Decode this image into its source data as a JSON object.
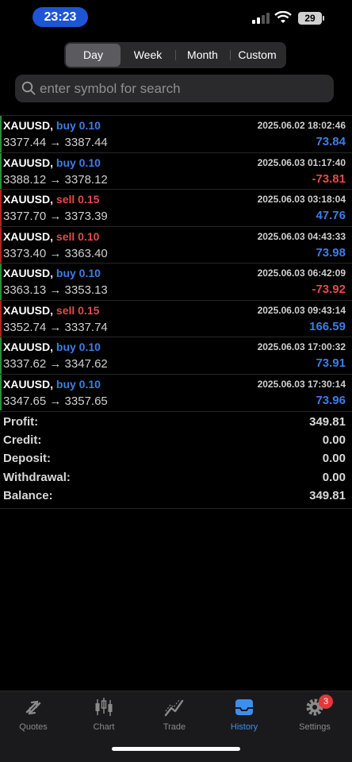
{
  "status_bar": {
    "time": "23:23",
    "battery": "29"
  },
  "period_tabs": [
    "Day",
    "Week",
    "Month",
    "Custom"
  ],
  "active_period": "Day",
  "search": {
    "placeholder": "enter symbol for search"
  },
  "deals": [
    {
      "symbol": "XAUUSD,",
      "type": "buy",
      "volume": "buy 0.10",
      "time": "2025.06.02 18:02:46",
      "prices": "3377.44 → 3387.44",
      "profit": "73.84"
    },
    {
      "symbol": "XAUUSD,",
      "type": "buy",
      "volume": "buy 0.10",
      "time": "2025.06.03 01:17:40",
      "prices": "3388.12 → 3378.12",
      "profit": "-73.81"
    },
    {
      "symbol": "XAUUSD,",
      "type": "sell",
      "volume": "sell 0.15",
      "time": "2025.06.03 03:18:04",
      "prices": "3377.70 → 3373.39",
      "profit": "47.76"
    },
    {
      "symbol": "XAUUSD,",
      "type": "sell",
      "volume": "sell 0.10",
      "time": "2025.06.03 04:43:33",
      "prices": "3373.40 → 3363.40",
      "profit": "73.98"
    },
    {
      "symbol": "XAUUSD,",
      "type": "buy",
      "volume": "buy 0.10",
      "time": "2025.06.03 06:42:09",
      "prices": "3363.13 → 3353.13",
      "profit": "-73.92"
    },
    {
      "symbol": "XAUUSD,",
      "type": "sell",
      "volume": "sell 0.15",
      "time": "2025.06.03 09:43:14",
      "prices": "3352.74 → 3337.74",
      "profit": "166.59"
    },
    {
      "symbol": "XAUUSD,",
      "type": "buy",
      "volume": "buy 0.10",
      "time": "2025.06.03 17:00:32",
      "prices": "3337.62 → 3347.62",
      "profit": "73.91"
    },
    {
      "symbol": "XAUUSD,",
      "type": "buy",
      "volume": "buy 0.10",
      "time": "2025.06.03 17:30:14",
      "prices": "3347.65 → 3357.65",
      "profit": "73.96"
    }
  ],
  "summary": [
    {
      "label": "Profit:",
      "value": "349.81"
    },
    {
      "label": "Credit:",
      "value": "0.00"
    },
    {
      "label": "Deposit:",
      "value": "0.00"
    },
    {
      "label": "Withdrawal:",
      "value": "0.00"
    },
    {
      "label": "Balance:",
      "value": "349.81"
    }
  ],
  "tabbar": {
    "quotes": "Quotes",
    "chart": "Chart",
    "trade": "Trade",
    "history": "History",
    "settings": "Settings",
    "settings_badge": "3"
  },
  "colors": {
    "buy": "#3d7de6",
    "sell": "#e24b4b",
    "accent": "#3d8ef0"
  },
  "icons": {
    "signal": "cellular-signal-icon",
    "wifi": "wifi-icon",
    "battery": "battery-icon",
    "search": "search-icon",
    "quotes": "quotes-arrows-icon",
    "chart": "candlestick-icon",
    "trade": "trade-line-icon",
    "history": "inbox-tray-icon",
    "settings": "gear-icon"
  }
}
